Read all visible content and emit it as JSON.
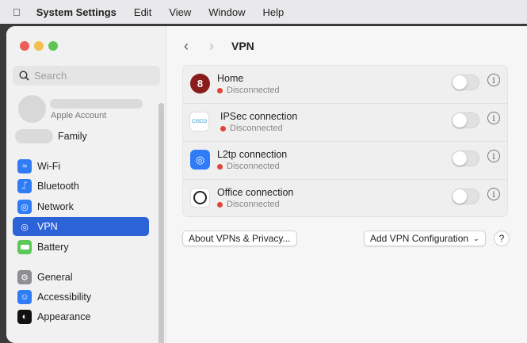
{
  "menubar": {
    "app": "System Settings",
    "items": [
      "Edit",
      "View",
      "Window",
      "Help"
    ]
  },
  "sidebar": {
    "search_placeholder": "Search",
    "account_label": "Apple Account",
    "family_label": "Family",
    "items": [
      {
        "label": "Wi-Fi",
        "icon": "wifi-icon",
        "color": "#2f7cf6"
      },
      {
        "label": "Bluetooth",
        "icon": "bluetooth-icon",
        "color": "#2f7cf6"
      },
      {
        "label": "Network",
        "icon": "globe-icon",
        "color": "#2f7cf6"
      },
      {
        "label": "VPN",
        "icon": "vpn-globe-icon",
        "color": "#2c63d6",
        "selected": true
      },
      {
        "label": "Battery",
        "icon": "battery-icon",
        "color": "#5cc85a"
      },
      {
        "label": "General",
        "icon": "gear-icon",
        "color": "#8e8e93"
      },
      {
        "label": "Accessibility",
        "icon": "accessibility-icon",
        "color": "#2f7cf6"
      },
      {
        "label": "Appearance",
        "icon": "appearance-icon",
        "color": "#111111"
      }
    ]
  },
  "main": {
    "title": "VPN",
    "connections": [
      {
        "name": "Home",
        "status": "Disconnected",
        "icon": "wireguard-icon",
        "enabled": false
      },
      {
        "name": "IPSec connection",
        "status": "Disconnected",
        "icon": "cisco-icon",
        "enabled": false
      },
      {
        "name": "L2tp connection",
        "status": "Disconnected",
        "icon": "vpn-globe-icon",
        "enabled": false
      },
      {
        "name": "Office connection",
        "status": "Disconnected",
        "icon": "office-vpn-icon",
        "enabled": false
      }
    ],
    "about_button": "About VPNs & Privacy...",
    "add_button": "Add VPN Configuration",
    "help_button": "?"
  }
}
